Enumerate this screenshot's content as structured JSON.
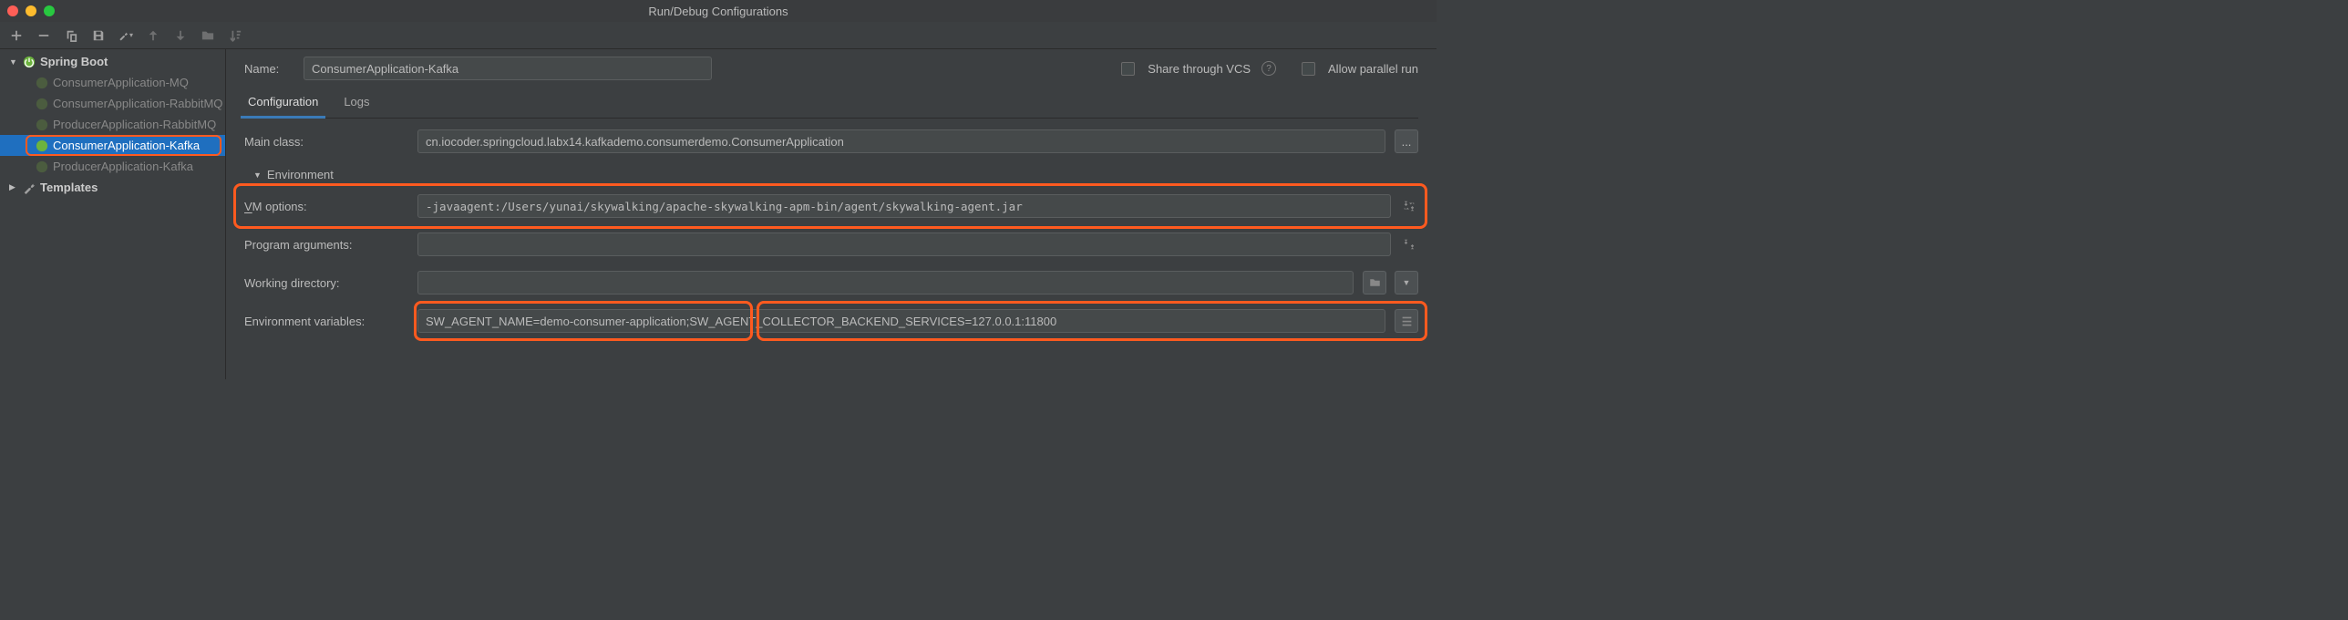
{
  "window": {
    "title": "Run/Debug Configurations"
  },
  "tree": {
    "root": "Spring Boot",
    "items": [
      "ConsumerApplication-MQ",
      "ConsumerApplication-RabbitMQ",
      "ProducerApplication-RabbitMQ",
      "ConsumerApplication-Kafka",
      "ProducerApplication-Kafka"
    ],
    "templates": "Templates"
  },
  "form": {
    "name_label": "Name:",
    "name": "ConsumerApplication-Kafka",
    "share_label": "Share through VCS",
    "parallel_label": "Allow parallel run",
    "tabs": {
      "config": "Configuration",
      "logs": "Logs"
    },
    "mainclass_label": "Main class:",
    "mainclass": "cn.iocoder.springcloud.labx14.kafkademo.consumerdemo.ConsumerApplication",
    "env_section": "Environment",
    "vm_label_pre": "V",
    "vm_label_post": "M options:",
    "vm": "-javaagent:/Users/yunai/skywalking/apache-skywalking-apm-bin/agent/skywalking-agent.jar",
    "prog_label": "Program arguments:",
    "prog": "",
    "workdir_label": "Working directory:",
    "workdir": "",
    "envvar_label": "Environment variables:",
    "envvar": "SW_AGENT_NAME=demo-consumer-application;SW_AGENT_COLLECTOR_BACKEND_SERVICES=127.0.0.1:11800",
    "browse_btn": "..."
  }
}
